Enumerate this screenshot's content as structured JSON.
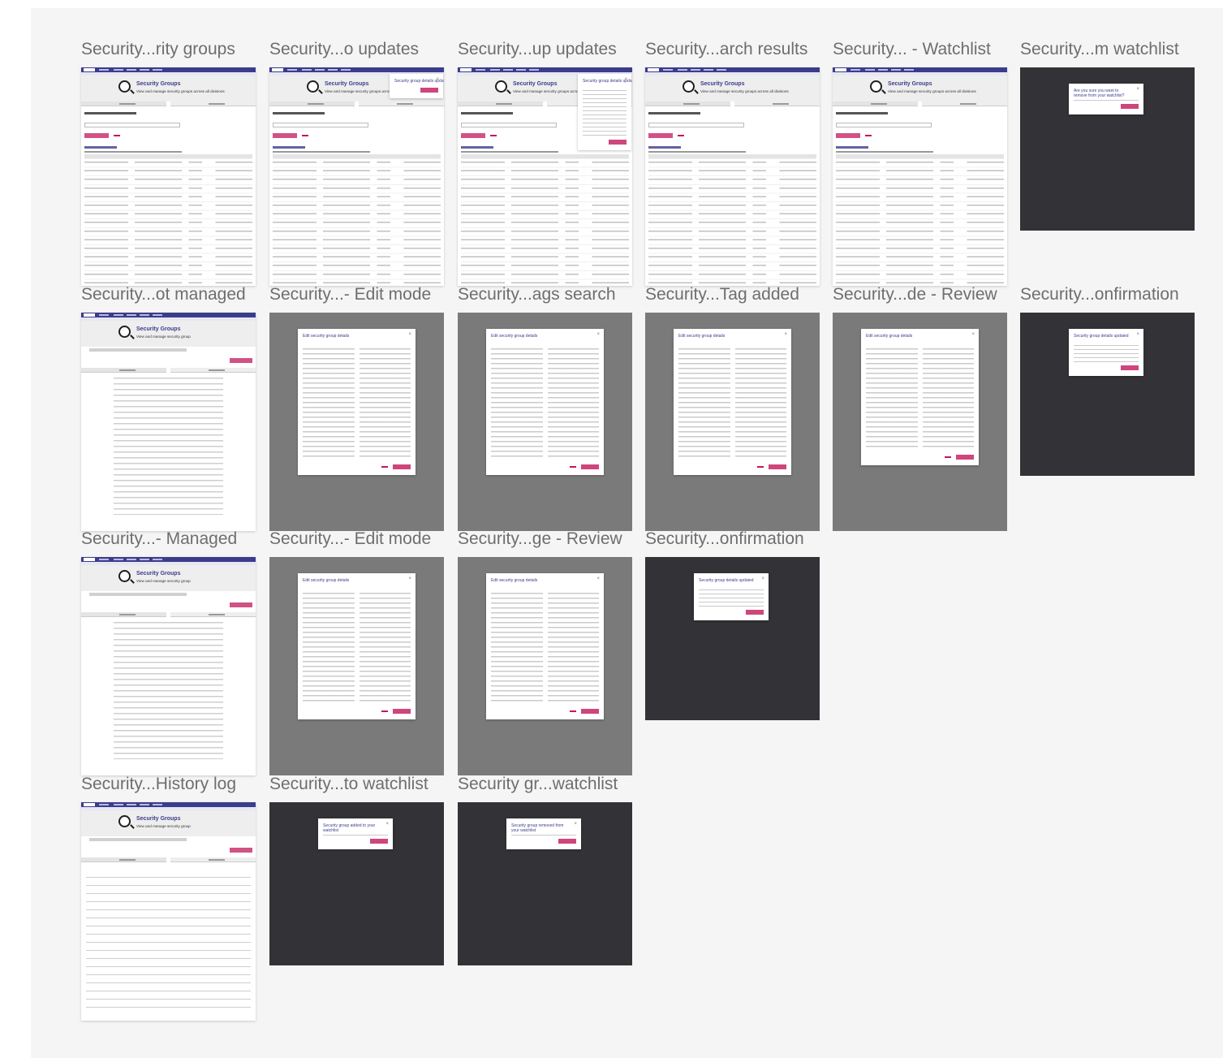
{
  "board": {
    "frames": [
      {
        "title": "Security...rity groups",
        "variant": "list",
        "col": 0,
        "row": 0
      },
      {
        "title": "Security...o updates",
        "variant": "list",
        "col": 1,
        "row": 0
      },
      {
        "title": "Security...up updates",
        "variant": "list",
        "col": 2,
        "row": 0
      },
      {
        "title": "Security...arch results",
        "variant": "list",
        "col": 3,
        "row": 0
      },
      {
        "title": "Security... - Watchlist",
        "variant": "list",
        "col": 4,
        "row": 0
      },
      {
        "title": "Security...m watchlist",
        "variant": "dialog",
        "col": 5,
        "row": 0
      },
      {
        "title": "Security...ot managed",
        "variant": "detail",
        "col": 0,
        "row": 1
      },
      {
        "title": "Security...- Edit mode",
        "variant": "edit",
        "col": 1,
        "row": 1
      },
      {
        "title": "Security...ags search",
        "variant": "edit",
        "col": 2,
        "row": 1
      },
      {
        "title": "Security...Tag added",
        "variant": "edit",
        "col": 3,
        "row": 1
      },
      {
        "title": "Security...de - Review",
        "variant": "edit",
        "col": 4,
        "row": 1
      },
      {
        "title": "Security...onfirmation",
        "variant": "dialog",
        "col": 5,
        "row": 1
      },
      {
        "title": "Security...- Managed",
        "variant": "detail",
        "col": 0,
        "row": 2
      },
      {
        "title": "Security...- Edit mode",
        "variant": "edit",
        "col": 1,
        "row": 2
      },
      {
        "title": "Security...ge - Review",
        "variant": "edit",
        "col": 2,
        "row": 2
      },
      {
        "title": "Security...onfirmation",
        "variant": "dialog",
        "col": 3,
        "row": 2
      },
      {
        "title": "Security...History log",
        "variant": "history",
        "col": 0,
        "row": 3
      },
      {
        "title": "Security...to watchlist",
        "variant": "dialog",
        "col": 1,
        "row": 3
      },
      {
        "title": "Security gr...watchlist",
        "variant": "dialog",
        "col": 2,
        "row": 3
      }
    ]
  },
  "page": {
    "title": "Security Groups",
    "subtitle_all": "View and manage security groups across all divisions",
    "subtitle_one": "View and manage security group"
  },
  "modals": {
    "edit_title": "Edit security group details",
    "remove_watchlist": "Are you sure you want to remove from your watchlist?",
    "details_updated": "Security group details updated",
    "added_watchlist": "Security group added to your watchlist",
    "removed_watchlist": "Security group removed from your watchlist",
    "close_glyph": "×"
  }
}
